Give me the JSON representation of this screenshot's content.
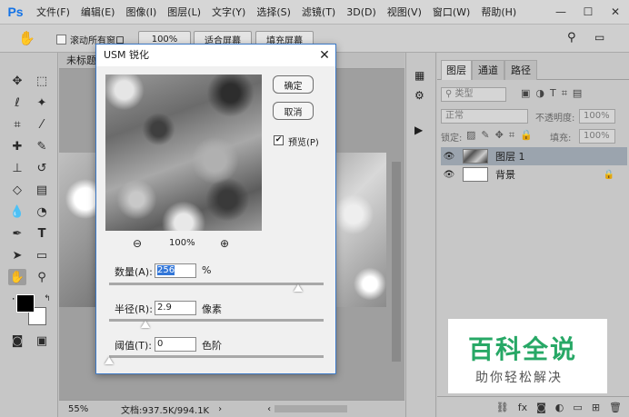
{
  "app": {
    "logo": "Ps",
    "menu": [
      "文件(F)",
      "编辑(E)",
      "图像(I)",
      "图层(L)",
      "文字(Y)",
      "选择(S)",
      "滤镜(T)",
      "3D(D)",
      "视图(V)",
      "窗口(W)",
      "帮助(H)"
    ]
  },
  "options_bar": {
    "scroll_all_label": "滚动所有窗口",
    "zoom_100": "100%",
    "fit_screen": "适合屏幕",
    "fill_screen": "填充屏幕"
  },
  "document": {
    "tab_title": "未标题",
    "zoom": "55%",
    "doc_info": "文档:937.5K/994.1K"
  },
  "layers_panel": {
    "tabs": [
      "图层",
      "通道",
      "路径"
    ],
    "filter_kind": "类型",
    "blend_mode": "正常",
    "opacity_label": "不透明度:",
    "opacity_value": "100%",
    "lock_label": "锁定:",
    "fill_label": "填充:",
    "fill_value": "100%",
    "layers": [
      {
        "name": "图层 1"
      },
      {
        "name": "背景"
      }
    ]
  },
  "dialog": {
    "title": "USM 锐化",
    "ok": "确定",
    "cancel": "取消",
    "preview_label": "预览(P)",
    "preview_checked": true,
    "zoom_level": "100%",
    "amount": {
      "label": "数量(A):",
      "value": "256",
      "unit": "%",
      "slider_fraction": 0.88
    },
    "radius": {
      "label": "半径(R):",
      "value": "2.9",
      "unit": "像素",
      "slider_fraction": 0.17
    },
    "threshold": {
      "label": "阈值(T):",
      "value": "0",
      "unit": "色阶",
      "slider_fraction": 0.0
    }
  },
  "watermark": {
    "title": "百科全说",
    "subtitle": "助你轻松解决",
    "color": "#27a866"
  }
}
